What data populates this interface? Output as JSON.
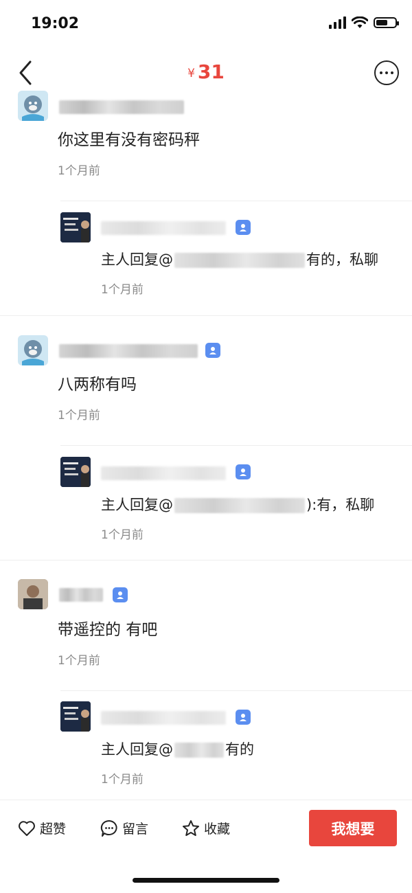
{
  "status_bar": {
    "time": "19:02",
    "battery_level": 0.6
  },
  "header": {
    "currency": "¥",
    "price": "31"
  },
  "comments": [
    {
      "text": "你这里有没有密码秤",
      "time": "1个月前",
      "reply": {
        "prefix": "主人回复@",
        "suffix": "有的，私聊",
        "time": "1个月前"
      }
    },
    {
      "text": "八两称有吗",
      "time": "1个月前",
      "reply": {
        "prefix": "主人回复@",
        "suffix": "):有，私聊",
        "time": "1个月前"
      }
    },
    {
      "text": "带遥控的 有吧",
      "time": "1个月前",
      "reply": {
        "prefix": "主人回复@",
        "suffix": "有的",
        "time": "1个月前"
      }
    }
  ],
  "bottom_bar": {
    "like_label": "超赞",
    "comment_label": "留言",
    "favorite_label": "收藏",
    "want_label": "我想要"
  },
  "colors": {
    "accent": "#e8463d",
    "badge": "#5b8ef0"
  }
}
